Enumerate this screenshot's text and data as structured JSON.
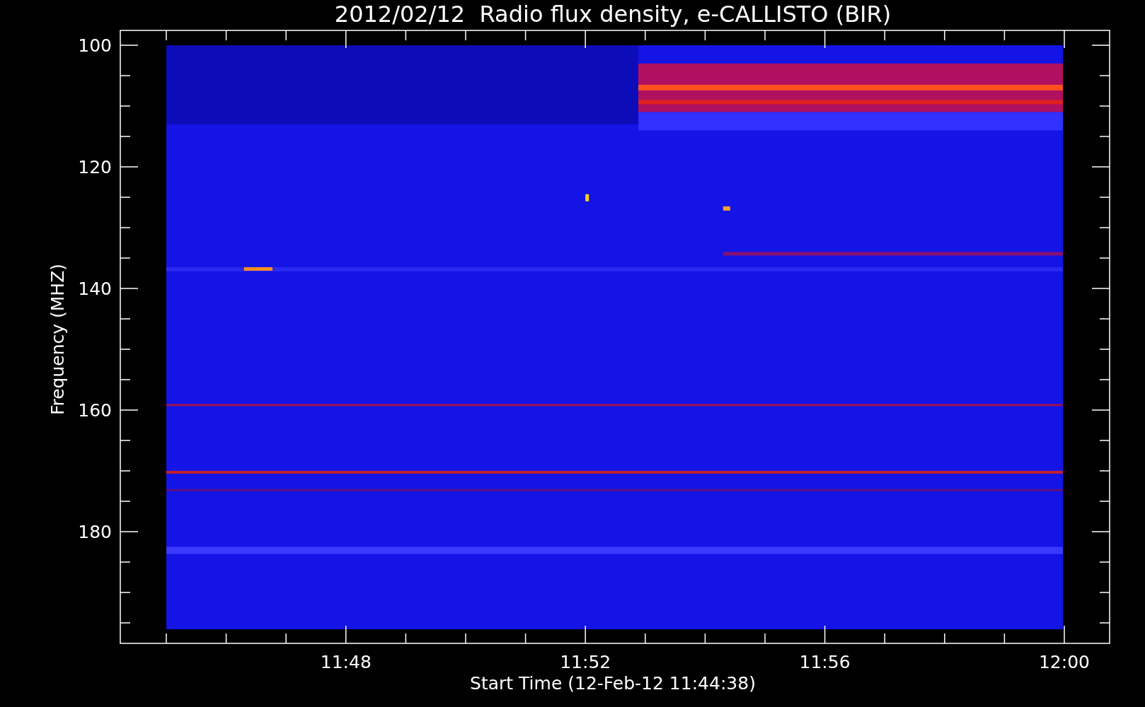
{
  "title": "2012/02/12  Radio flux density, e-CALLISTO (BIR)",
  "y_axis": {
    "label": "Frequency (MHZ)",
    "tick_labels": [
      "100",
      "120",
      "140",
      "160",
      "180"
    ]
  },
  "x_axis": {
    "label": "Start Time (12-Feb-12 11:44:38)",
    "tick_labels": [
      "11:48",
      "11:52",
      "11:56",
      "12:00"
    ]
  }
}
